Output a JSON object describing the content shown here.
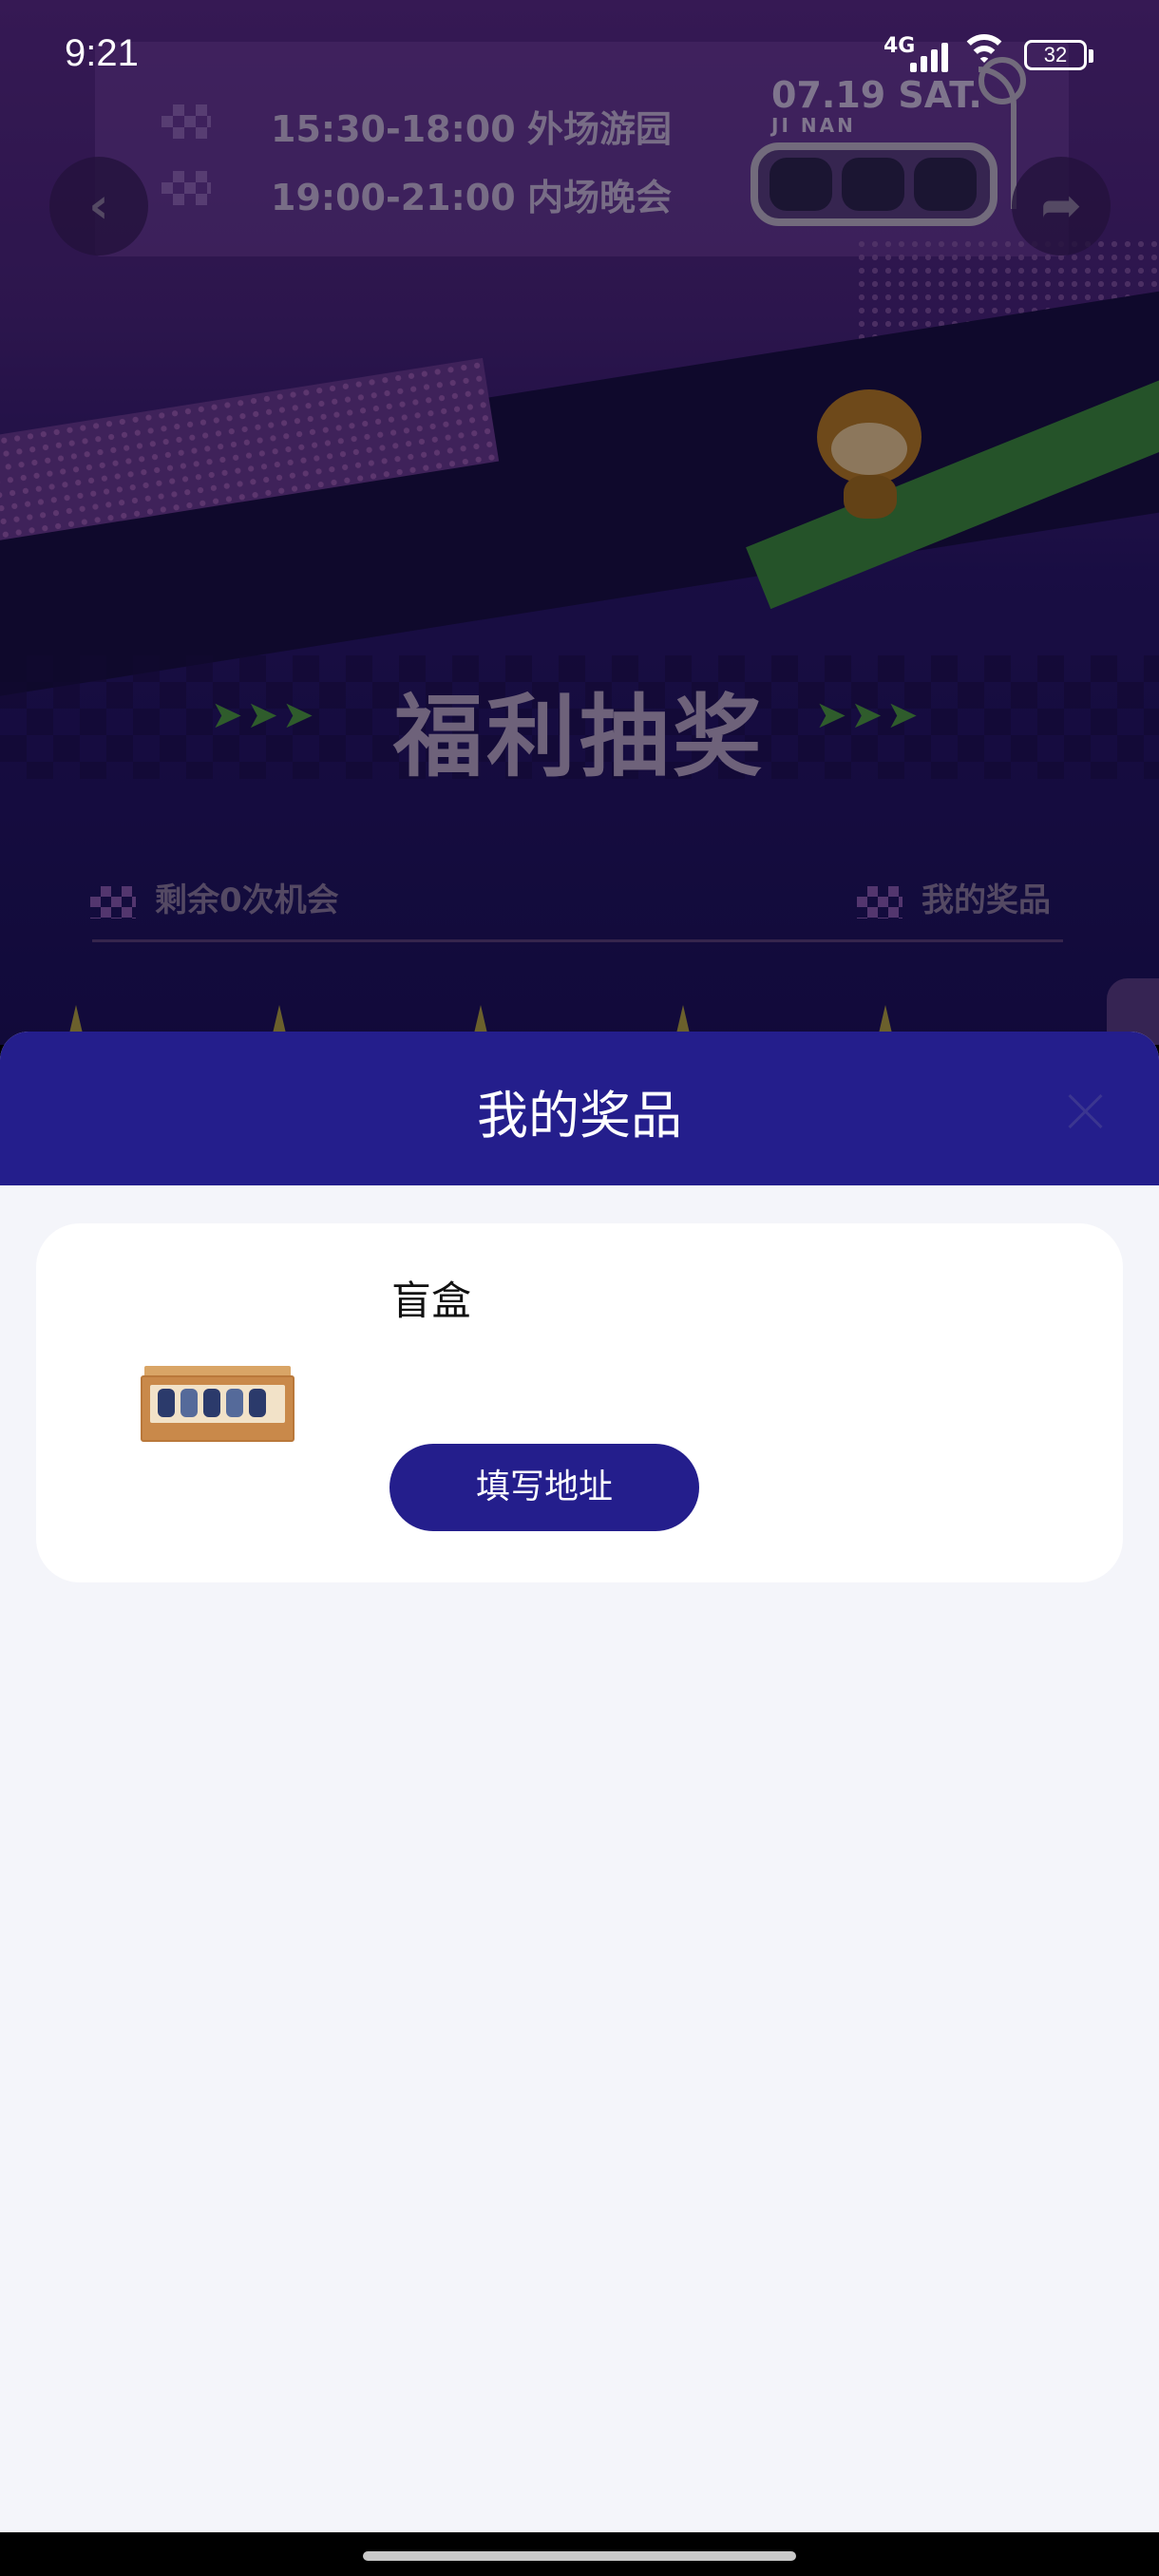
{
  "status_bar": {
    "time": "9:21",
    "network": "4G",
    "battery": "32"
  },
  "background": {
    "schedule": [
      {
        "time": "15:30-18:00",
        "label": "外场游园"
      },
      {
        "time": "19:00-21:00",
        "label": "内场晚会"
      }
    ],
    "date": "07.19 SAT.",
    "city": "JI NAN",
    "lottery_title": "福利抽奖",
    "remaining_chances": "剩余0次机会",
    "my_prizes_link": "我的奖品",
    "back_icon": "chevron-left-icon",
    "share_icon": "share-icon"
  },
  "sheet": {
    "title": "我的奖品",
    "close_icon": "close-icon",
    "prizes": [
      {
        "name": "盲盒",
        "action_label": "填写地址"
      }
    ]
  },
  "colors": {
    "header": "#241e8c",
    "button": "#241e8c",
    "sheet_bg": "#f4f5fa"
  }
}
